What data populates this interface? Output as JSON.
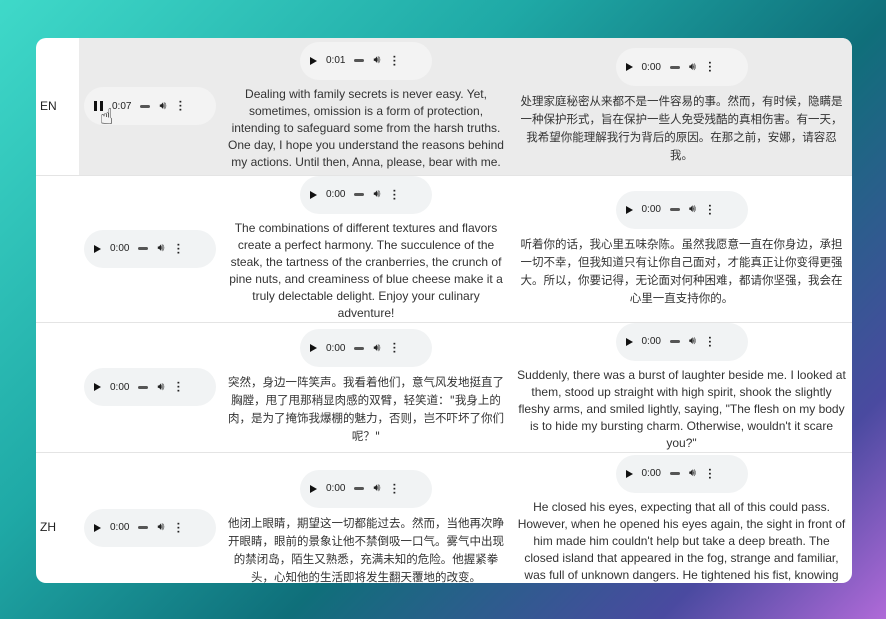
{
  "rows": [
    {
      "lang": "EN",
      "source_time": "0:07",
      "source_state": "playing",
      "mid_time": "0:01",
      "mid_text": "Dealing with family secrets is never easy. Yet, sometimes, omission is a form of protection, intending to safeguard some from the harsh truths. One day, I hope you understand the reasons behind my actions. Until then, Anna, please, bear with me.",
      "right_time": "0:00",
      "right_text": "处理家庭秘密从来都不是一件容易的事。然而，有时候，隐瞒是一种保护形式，旨在保护一些人免受残酷的真相伤害。有一天，我希望你能理解我行为背后的原因。在那之前，安娜，请容忍我。"
    },
    {
      "lang": "",
      "source_time": "0:00",
      "mid_time": "0:00",
      "mid_text": "The combinations of different textures and flavors create a perfect harmony. The succulence of the steak, the tartness of the cranberries, the crunch of pine nuts, and creaminess of blue cheese make it a truly delectable delight. Enjoy your culinary adventure!",
      "right_time": "0:00",
      "right_text": "听着你的话，我心里五味杂陈。虽然我愿意一直在你身边，承担一切不幸，但我知道只有让你自己面对，才能真正让你变得更强大。所以，你要记得，无论面对何种困难，都请你坚强，我会在心里一直支持你的。"
    },
    {
      "lang": "",
      "source_time": "0:00",
      "mid_time": "0:00",
      "mid_text": "突然，身边一阵笑声。我看着他们，意气风发地挺直了胸膛，甩了甩那稍显肉感的双臂，轻笑道：\"我身上的肉，是为了掩饰我爆棚的魅力，否则，岂不吓坏了你们呢？\"",
      "right_time": "0:00",
      "right_text": "Suddenly, there was a burst of laughter beside me. I looked at them, stood up straight with high spirit, shook the slightly fleshy arms, and smiled lightly, saying, \"The flesh on my body is to hide my bursting charm. Otherwise, wouldn't it scare you?\""
    },
    {
      "lang": "ZH",
      "source_time": "0:00",
      "mid_time": "0:00",
      "mid_text": "他闭上眼睛，期望这一切都能过去。然而，当他再次睁开眼睛，眼前的景象让他不禁倒吸一口气。雾气中出现的禁闭岛，陌生又熟悉，充满未知的危险。他握紧拳头，心知他的生活即将发生翻天覆地的改变。",
      "right_time": "0:00",
      "right_text": "He closed his eyes, expecting that all of this could pass. However, when he opened his eyes again, the sight in front of him made him couldn't help but take a deep breath. The closed island that appeared in the fog, strange and familiar, was full of unknown dangers. He tightened his fist, knowing that his life was about to undergo earth-shaking changes."
    }
  ]
}
